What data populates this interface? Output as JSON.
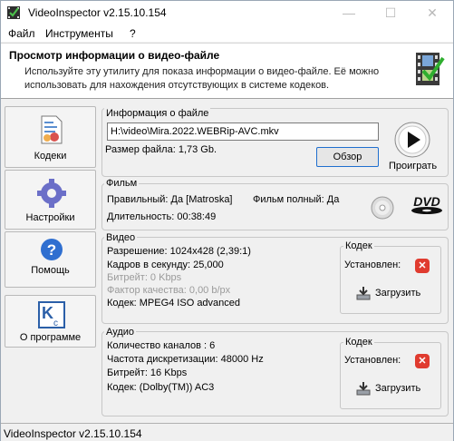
{
  "window": {
    "title": "VideoInspector v2.15.10.154",
    "min_glyph": "—",
    "max_glyph": "☐",
    "close_glyph": "✕"
  },
  "menu": {
    "items": [
      "Файл",
      "Инструменты",
      "?"
    ]
  },
  "header": {
    "title": "Просмотр информации о видео-файле",
    "description": "Используйте эту утилиту для показа информации о видео-файле. Её можно использовать для нахождения отсутствующих в системе кодеков."
  },
  "nav": {
    "codecs": "Кодеки",
    "settings": "Настройки",
    "help": "Помощь",
    "about": "О программе"
  },
  "file_panel": {
    "label": "Информация о файле",
    "path": "H:\\video\\Mira.2022.WEBRip-AVC.mkv",
    "size": "Размер файла: 1,73 Gb.",
    "browse": "Обзор",
    "play": "Проиграть"
  },
  "film_panel": {
    "label": "Фильм",
    "valid": "Правильный: Да [Matroska]",
    "complete": "Фильм полный: Да",
    "duration": "Длительность: 00:38:49",
    "dvd_text": "DVD"
  },
  "video_panel": {
    "label": "Видео",
    "resolution": "Разрешение: 1024x428 (2,39:1)",
    "fps": "Кадров в секунду: 25,000",
    "bitrate": "Битрейт: 0 Kbps",
    "quality": "Фактор качества: 0,00 b/px",
    "codec": "Кодек: MPEG4 ISO advanced",
    "codec_box": {
      "label": "Кодек",
      "installed": "Установлен:",
      "download": "Загрузить"
    }
  },
  "audio_panel": {
    "label": "Аудио",
    "channels": "Количество каналов : 6",
    "sample_rate": "Частота дискретизации: 48000 Hz",
    "bitrate": "Битрейт: 16 Kbps",
    "codec": "Кодек: (Dolby(TM)) AC3",
    "codec_box": {
      "label": "Кодек",
      "installed": "Установлен:",
      "download": "Загрузить"
    }
  },
  "statusbar": {
    "text": "VideoInspector v2.15.10.154"
  },
  "colors": {
    "accent": "#1f6fcf",
    "error": "#e03b2f"
  }
}
